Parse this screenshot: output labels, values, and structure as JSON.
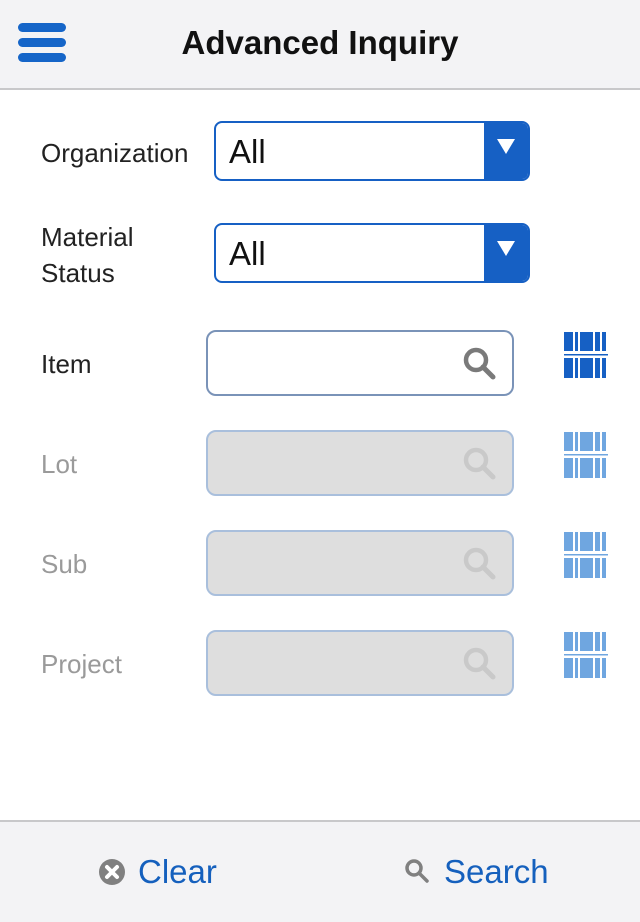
{
  "header": {
    "title": "Advanced Inquiry",
    "menu_icon": "hamburger-menu-icon"
  },
  "form": {
    "organization": {
      "label": "Organization",
      "value": "All"
    },
    "material_status": {
      "label_line1": "Material",
      "label_line2": "Status",
      "value": "All"
    },
    "item": {
      "label": "Item",
      "value": "",
      "placeholder": "",
      "enabled": true
    },
    "lot": {
      "label": "Lot",
      "value": "",
      "placeholder": "",
      "enabled": false
    },
    "sub": {
      "label": "Sub",
      "value": "",
      "placeholder": "",
      "enabled": false
    },
    "project": {
      "label": "Project",
      "value": "",
      "placeholder": "",
      "enabled": false
    }
  },
  "footer": {
    "clear_label": "Clear",
    "search_label": "Search"
  },
  "colors": {
    "accent": "#1660c4",
    "accent_disabled": "#6fa6e0",
    "header_bg": "#f3f3f5",
    "disabled_field_bg": "#dedede"
  }
}
